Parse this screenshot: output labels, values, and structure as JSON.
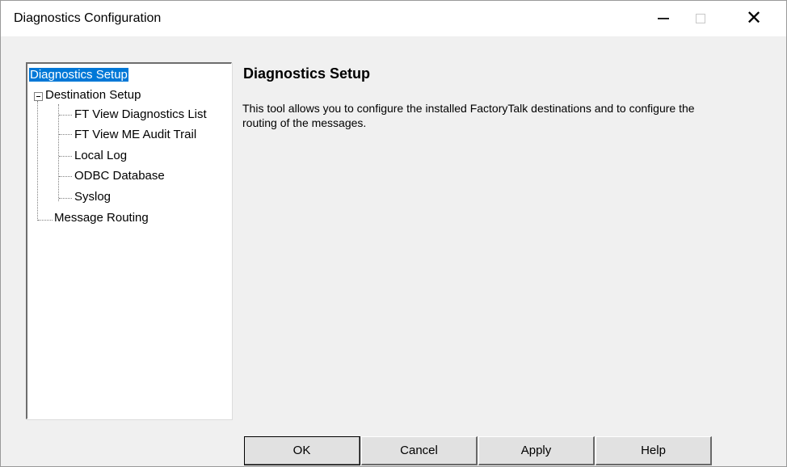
{
  "window": {
    "title": "Diagnostics Configuration",
    "controls": {
      "minimize_icon": "minimize-icon",
      "maximize_icon": "maximize-icon",
      "close_icon": "close-icon"
    }
  },
  "tree": {
    "root": "Diagnostics Setup",
    "destination": "Destination Setup",
    "children": [
      "FT View Diagnostics List",
      "FT View ME Audit Trail",
      "Local Log",
      "ODBC Database",
      "Syslog"
    ],
    "routing": "Message Routing"
  },
  "content": {
    "heading": "Diagnostics Setup",
    "description": "This tool allows you to configure the installed FactoryTalk destinations and to configure the routing of the messages."
  },
  "buttons": {
    "ok": "OK",
    "cancel": "Cancel",
    "apply": "Apply",
    "help": "Help"
  },
  "colors": {
    "selection": "#0078d7",
    "background": "#f0f0f0"
  }
}
